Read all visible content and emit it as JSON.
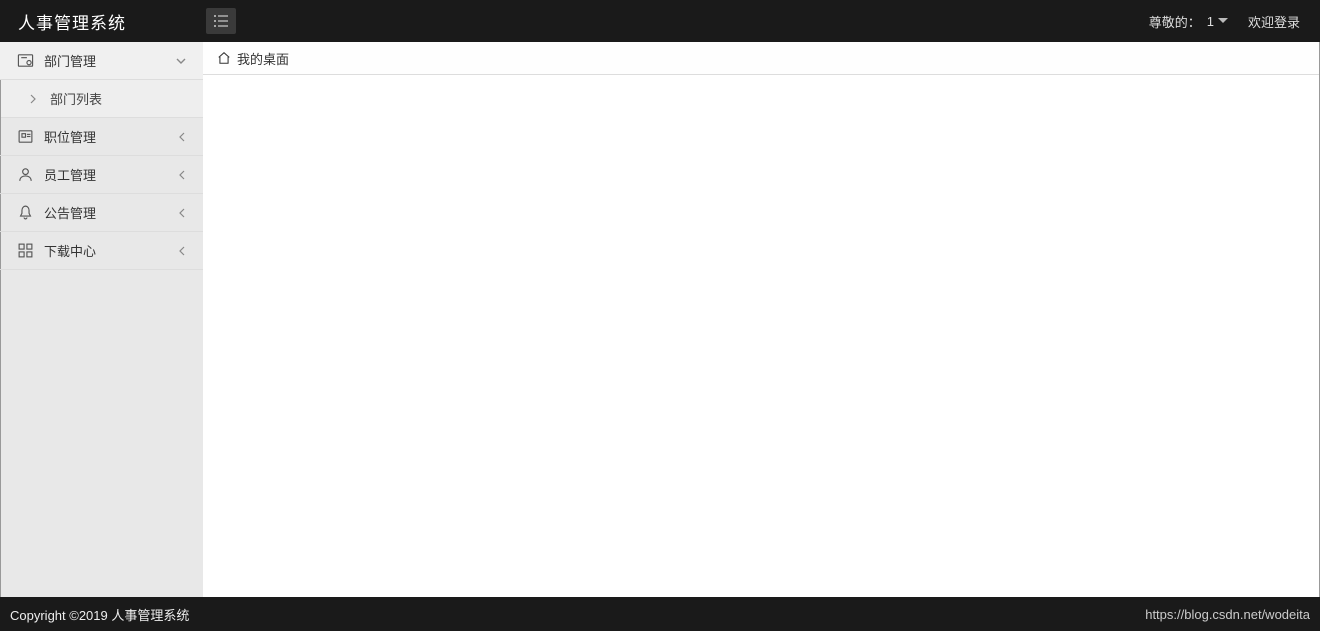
{
  "header": {
    "title": "人事管理系统",
    "greeting_prefix": "尊敬的：",
    "username": "1",
    "welcome": "欢迎登录"
  },
  "sidebar": {
    "items": [
      {
        "label": "部门管理",
        "icon": "folder-settings-icon",
        "expanded": true
      },
      {
        "label": "职位管理",
        "icon": "badge-icon",
        "expanded": false
      },
      {
        "label": "员工管理",
        "icon": "user-icon",
        "expanded": false
      },
      {
        "label": "公告管理",
        "icon": "bell-icon",
        "expanded": false
      },
      {
        "label": "下载中心",
        "icon": "grid-icon",
        "expanded": false
      }
    ],
    "subitems": [
      {
        "label": "部门列表"
      }
    ]
  },
  "tabs": [
    {
      "label": "我的桌面",
      "icon": "home-icon"
    }
  ],
  "footer": {
    "copyright": "Copyright ©2019 人事管理系统",
    "watermark": "https://blog.csdn.net/wodeita"
  }
}
